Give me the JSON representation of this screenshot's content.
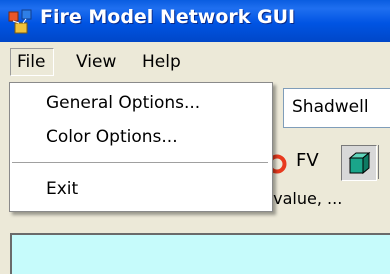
{
  "window": {
    "title": "Fire Model Network GUI"
  },
  "menubar": {
    "file": "File",
    "view": "View",
    "help": "Help"
  },
  "file_menu": {
    "items": [
      "General Options...",
      "Color Options...",
      "Exit"
    ]
  },
  "combo": {
    "value": "Shadwell"
  },
  "toolbar": {
    "fv_label": "FV"
  },
  "status": {
    "text": "Smoke and Fire:  opacity upper value, ..."
  },
  "colors": {
    "titlebar": "#0054e3",
    "canvas": "#c6fbfb",
    "cube": "#1aa58a",
    "fv_ring": "#e83a1e"
  }
}
